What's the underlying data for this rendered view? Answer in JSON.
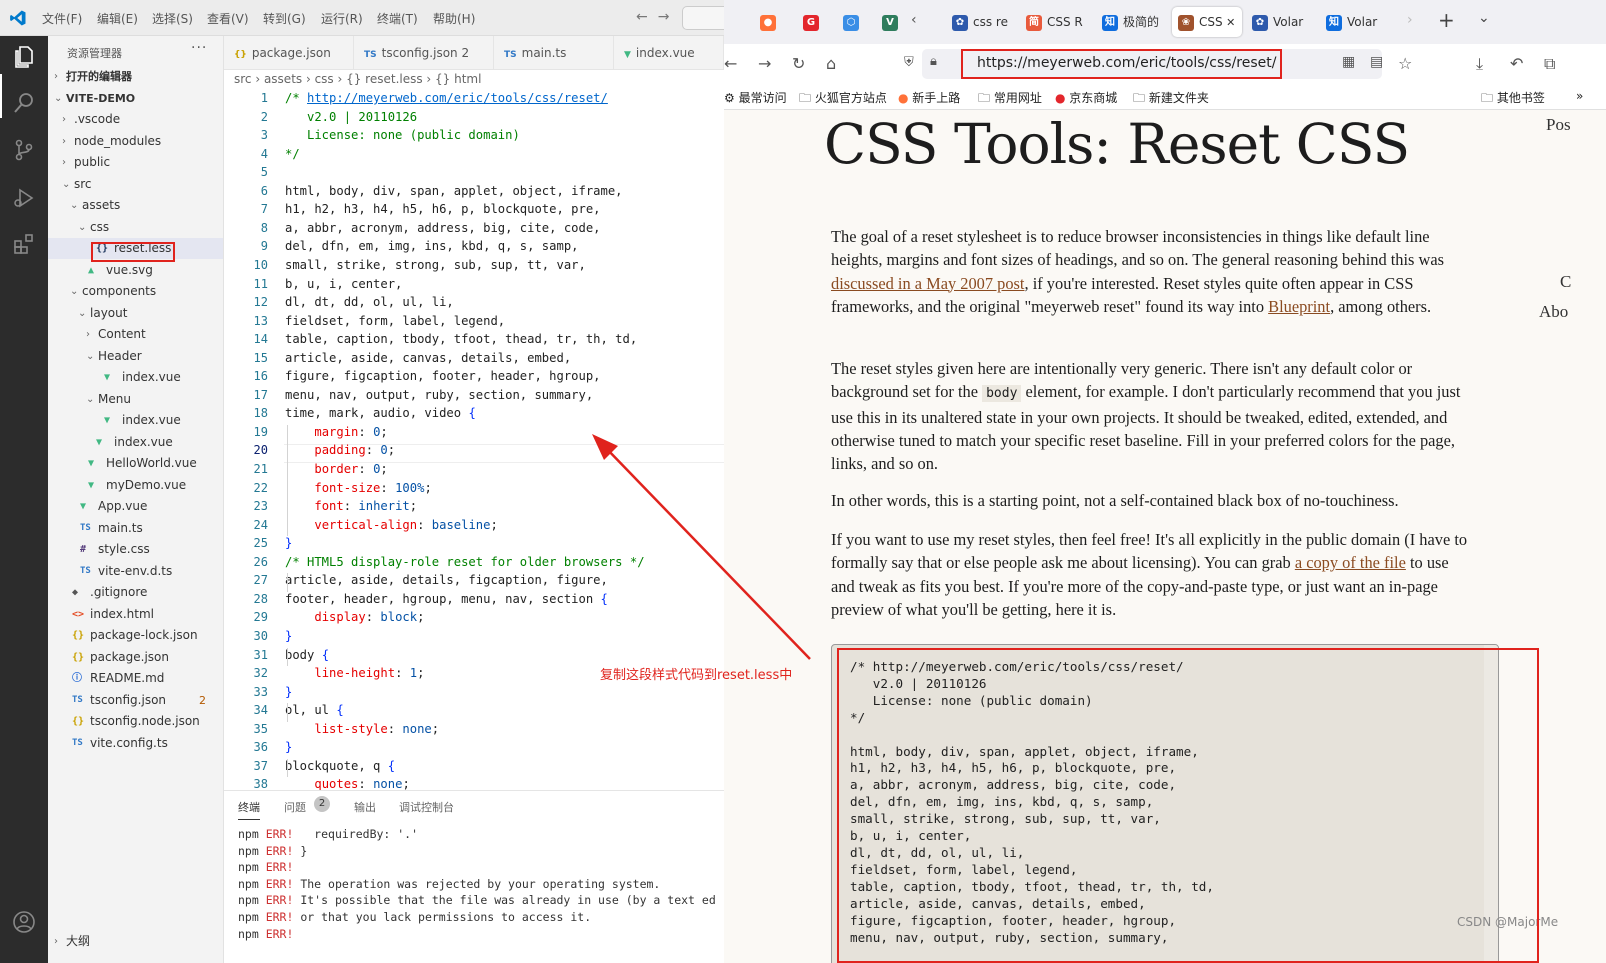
{
  "vscode": {
    "menu": [
      "文件(F)",
      "编辑(E)",
      "选择(S)",
      "查看(V)",
      "转到(G)",
      "运行(R)",
      "终端(T)",
      "帮助(H)"
    ],
    "explorer_title": "资源管理器",
    "more_label": "···",
    "tree": [
      {
        "label": "打开的编辑器",
        "indent": 0,
        "chev": "›",
        "icon": ""
      },
      {
        "label": "VITE-DEMO",
        "indent": 0,
        "chev": "⌄",
        "icon": ""
      },
      {
        "label": ".vscode",
        "indent": 1,
        "chev": "›",
        "icon": ""
      },
      {
        "label": "node_modules",
        "indent": 1,
        "chev": "›",
        "icon": ""
      },
      {
        "label": "public",
        "indent": 1,
        "chev": "›",
        "icon": ""
      },
      {
        "label": "src",
        "indent": 1,
        "chev": "⌄",
        "icon": ""
      },
      {
        "label": "assets",
        "indent": 2,
        "chev": "⌄",
        "icon": ""
      },
      {
        "label": "css",
        "indent": 3,
        "chev": "⌄",
        "icon": ""
      },
      {
        "label": "reset.less",
        "indent": 4,
        "chev": "",
        "icon": "{}",
        "icon_class": "ic-less",
        "selected": true
      },
      {
        "label": "vue.svg",
        "indent": 3,
        "chev": "",
        "icon": "▲",
        "icon_class": "ic-vue"
      },
      {
        "label": "components",
        "indent": 2,
        "chev": "⌄",
        "icon": ""
      },
      {
        "label": "layout",
        "indent": 3,
        "chev": "⌄",
        "icon": ""
      },
      {
        "label": "Content",
        "indent": 4,
        "chev": "›",
        "icon": ""
      },
      {
        "label": "Header",
        "indent": 4,
        "chev": "⌄",
        "icon": ""
      },
      {
        "label": "index.vue",
        "indent": 5,
        "chev": "",
        "icon": "▼",
        "icon_class": "ic-vue"
      },
      {
        "label": "Menu",
        "indent": 4,
        "chev": "⌄",
        "icon": ""
      },
      {
        "label": "index.vue",
        "indent": 5,
        "chev": "",
        "icon": "▼",
        "icon_class": "ic-vue"
      },
      {
        "label": "index.vue",
        "indent": 4,
        "chev": "",
        "icon": "▼",
        "icon_class": "ic-vue"
      },
      {
        "label": "HelloWorld.vue",
        "indent": 3,
        "chev": "",
        "icon": "▼",
        "icon_class": "ic-vue"
      },
      {
        "label": "myDemo.vue",
        "indent": 3,
        "chev": "",
        "icon": "▼",
        "icon_class": "ic-vue"
      },
      {
        "label": "App.vue",
        "indent": 2,
        "chev": "",
        "icon": "▼",
        "icon_class": "ic-vue"
      },
      {
        "label": "main.ts",
        "indent": 2,
        "chev": "",
        "icon": "TS",
        "icon_class": "ic-ts"
      },
      {
        "label": "style.css",
        "indent": 2,
        "chev": "",
        "icon": "#",
        "icon_class": "ic-css"
      },
      {
        "label": "vite-env.d.ts",
        "indent": 2,
        "chev": "",
        "icon": "TS",
        "icon_class": "ic-ts"
      },
      {
        "label": ".gitignore",
        "indent": 1,
        "chev": "",
        "icon": "◆",
        "icon_class": "ic-git"
      },
      {
        "label": "index.html",
        "indent": 1,
        "chev": "",
        "icon": "<>",
        "icon_class": "ic-html"
      },
      {
        "label": "package-lock.json",
        "indent": 1,
        "chev": "",
        "icon": "{}",
        "icon_class": "ic-json"
      },
      {
        "label": "package.json",
        "indent": 1,
        "chev": "",
        "icon": "{}",
        "icon_class": "ic-json"
      },
      {
        "label": "README.md",
        "indent": 1,
        "chev": "",
        "icon": "ⓘ",
        "icon_class": "ic-info"
      },
      {
        "label": "tsconfig.json",
        "indent": 1,
        "chev": "",
        "icon": "TS",
        "icon_class": "ic-ts",
        "badge": "2"
      },
      {
        "label": "tsconfig.node.json",
        "indent": 1,
        "chev": "",
        "icon": "{}",
        "icon_class": "ic-json"
      },
      {
        "label": "vite.config.ts",
        "indent": 1,
        "chev": "",
        "icon": "TS",
        "icon_class": "ic-ts"
      }
    ],
    "bottom_section": "大纲",
    "tabs": [
      {
        "label": "package.json",
        "icon": "{}",
        "icon_class": "ic-json"
      },
      {
        "label": "tsconfig.json 2",
        "icon": "TS",
        "icon_class": "ic-ts"
      },
      {
        "label": "main.ts",
        "icon": "TS",
        "icon_class": "ic-ts"
      },
      {
        "label": "index.vue",
        "icon": "▼",
        "icon_class": "ic-vue"
      }
    ],
    "breadcrumb": "src › assets › css › {} reset.less › {} html",
    "current_line": 20,
    "code_lines": [
      [
        [
          "c-com",
          "/* "
        ],
        [
          "c-link",
          "http://meyerweb.com/eric/tools/css/reset/"
        ]
      ],
      [
        [
          "c-com",
          "   v2.0 | 20110126"
        ]
      ],
      [
        [
          "c-com",
          "   License: none (public domain)"
        ]
      ],
      [
        [
          "c-com",
          "*/"
        ]
      ],
      [
        [
          "",
          ""
        ]
      ],
      [
        [
          "",
          "html, body, div, span, applet, object, iframe,"
        ]
      ],
      [
        [
          "",
          "h1, h2, h3, h4, h5, h6, p, blockquote, pre,"
        ]
      ],
      [
        [
          "",
          "a, abbr, acronym, address, big, cite, code,"
        ]
      ],
      [
        [
          "",
          "del, dfn, em, img, ins, kbd, q, s, samp,"
        ]
      ],
      [
        [
          "",
          "small, strike, strong, sub, sup, tt, var,"
        ]
      ],
      [
        [
          "",
          "b, u, i, center,"
        ]
      ],
      [
        [
          "",
          "dl, dt, dd, ol, ul, li,"
        ]
      ],
      [
        [
          "",
          "fieldset, form, label, legend,"
        ]
      ],
      [
        [
          "",
          "table, caption, tbody, tfoot, thead, tr, th, td,"
        ]
      ],
      [
        [
          "",
          "article, aside, canvas, details, embed,"
        ]
      ],
      [
        [
          "",
          "figure, figcaption, footer, header, hgroup,"
        ]
      ],
      [
        [
          "",
          "menu, nav, output, ruby, section, summary,"
        ]
      ],
      [
        [
          "",
          "time, mark, audio, video "
        ],
        [
          "c-br",
          "{"
        ]
      ],
      [
        [
          "",
          "    "
        ],
        [
          "c-prop",
          "margin"
        ],
        [
          "",
          ": "
        ],
        [
          "c-val",
          "0"
        ],
        [
          "",
          ";"
        ]
      ],
      [
        [
          "",
          "    "
        ],
        [
          "c-prop",
          "padding"
        ],
        [
          "",
          ": "
        ],
        [
          "c-val",
          "0"
        ],
        [
          "",
          ";"
        ]
      ],
      [
        [
          "",
          "    "
        ],
        [
          "c-prop",
          "border"
        ],
        [
          "",
          ": "
        ],
        [
          "c-val",
          "0"
        ],
        [
          "",
          ";"
        ]
      ],
      [
        [
          "",
          "    "
        ],
        [
          "c-prop",
          "font-size"
        ],
        [
          "",
          ": "
        ],
        [
          "c-val",
          "100%"
        ],
        [
          "",
          ";"
        ]
      ],
      [
        [
          "",
          "    "
        ],
        [
          "c-prop",
          "font"
        ],
        [
          "",
          ": "
        ],
        [
          "c-val",
          "inherit"
        ],
        [
          "",
          ";"
        ]
      ],
      [
        [
          "",
          "    "
        ],
        [
          "c-prop",
          "vertical-align"
        ],
        [
          "",
          ": "
        ],
        [
          "c-val",
          "baseline"
        ],
        [
          "",
          ";"
        ]
      ],
      [
        [
          "c-br",
          "}"
        ]
      ],
      [
        [
          "c-com",
          "/* HTML5 display-role reset for older browsers */"
        ]
      ],
      [
        [
          "",
          "article, aside, details, figcaption, figure,"
        ]
      ],
      [
        [
          "",
          "footer, header, hgroup, menu, nav, section "
        ],
        [
          "c-br",
          "{"
        ]
      ],
      [
        [
          "",
          "    "
        ],
        [
          "c-prop",
          "display"
        ],
        [
          "",
          ": "
        ],
        [
          "c-val",
          "block"
        ],
        [
          "",
          ";"
        ]
      ],
      [
        [
          "c-br",
          "}"
        ]
      ],
      [
        [
          "",
          "body "
        ],
        [
          "c-br",
          "{"
        ]
      ],
      [
        [
          "",
          "    "
        ],
        [
          "c-prop",
          "line-height"
        ],
        [
          "",
          ": "
        ],
        [
          "c-val",
          "1"
        ],
        [
          "",
          ";"
        ]
      ],
      [
        [
          "c-br",
          "}"
        ]
      ],
      [
        [
          "",
          "ol, ul "
        ],
        [
          "c-br",
          "{"
        ]
      ],
      [
        [
          "",
          "    "
        ],
        [
          "c-prop",
          "list-style"
        ],
        [
          "",
          ": "
        ],
        [
          "c-val",
          "none"
        ],
        [
          "",
          ";"
        ]
      ],
      [
        [
          "c-br",
          "}"
        ]
      ],
      [
        [
          "",
          "blockquote, q "
        ],
        [
          "c-br",
          "{"
        ]
      ],
      [
        [
          "",
          "    "
        ],
        [
          "c-prop",
          "quotes"
        ],
        [
          "",
          ": "
        ],
        [
          "c-val",
          "none"
        ],
        [
          "",
          ";"
        ]
      ]
    ],
    "panel_tabs": [
      "终端",
      "问题",
      "输出",
      "调试控制台"
    ],
    "problem_count": "2",
    "terminal_lines": [
      [
        [
          "",
          "npm "
        ],
        [
          "err",
          "ERR!"
        ],
        [
          "",
          "   requiredBy: '.'"
        ]
      ],
      [
        [
          "",
          "npm "
        ],
        [
          "err",
          "ERR!"
        ],
        [
          "",
          " }"
        ]
      ],
      [
        [
          "",
          "npm "
        ],
        [
          "err",
          "ERR!"
        ]
      ],
      [
        [
          "",
          "npm "
        ],
        [
          "err",
          "ERR!"
        ],
        [
          "",
          " The operation was rejected by your operating system."
        ]
      ],
      [
        [
          "",
          "npm "
        ],
        [
          "err",
          "ERR!"
        ],
        [
          "",
          " It's possible that the file was already in use (by a text ed"
        ]
      ],
      [
        [
          "",
          "npm "
        ],
        [
          "err",
          "ERR!"
        ],
        [
          "",
          " or that you lack permissions to access it."
        ]
      ],
      [
        [
          "",
          "npm "
        ],
        [
          "err",
          "ERR!"
        ]
      ]
    ]
  },
  "annotation": "复制这段样式代码到reset.less中",
  "browser": {
    "tabs": [
      {
        "label": "",
        "color": "#ff7139",
        "fav": "●"
      },
      {
        "label": "",
        "color": "#e3262c",
        "fav": "G"
      },
      {
        "label": "",
        "color": "#3a8ee6",
        "fav": "⬡"
      },
      {
        "label": "",
        "color": "#2f7d5d",
        "fav": "V"
      },
      {
        "label": "css re",
        "color": "#2e5aac",
        "fav": "✿"
      },
      {
        "label": "CSS R",
        "color": "#e85a3c",
        "fav": "简"
      },
      {
        "label": "极简的",
        "color": "#0f6dde",
        "fav": "知"
      },
      {
        "label": "CSS",
        "color": "#a0522d",
        "fav": "❀",
        "active": true
      },
      {
        "label": "Volar",
        "color": "#2e5aac",
        "fav": "✿"
      },
      {
        "label": "Volar",
        "color": "#0f6dde",
        "fav": "知"
      }
    ],
    "url": "https://meyerweb.com/eric/tools/css/reset/",
    "bookmarks": [
      "最常访问",
      "火狐官方站点",
      "新手上路",
      "常用网址",
      "京东商城",
      "新建文件夹"
    ],
    "other_bookmarks": "其他书签",
    "page": {
      "title": "CSS Tools: Reset CSS",
      "side_pos": "Pos",
      "side_c": "C",
      "side_abo": "Abo",
      "p1_a": "The goal of a reset stylesheet is to reduce browser inconsistencies in things like default line heights, margins and font sizes of headings, and so on. The general reasoning behind this was ",
      "p1_link1": "discussed in a May 2007 post",
      "p1_b": ", if you're interested. Reset styles quite often appear in CSS frameworks, and the original \"meyerweb reset\" found its way into ",
      "p1_link2": "Blueprint",
      "p1_c": ", among others.",
      "p2_a": "The reset styles given here are intentionally very generic. There isn't any default color or background set for the ",
      "p2_code": "body",
      "p2_b": " element, for example. I don't particularly recommend that you just use this in its unaltered state in your own projects. It should be tweaked, edited, extended, and otherwise tuned to match your specific reset baseline. Fill in your preferred colors for the page, links, and so on.",
      "p3": "In other words, this is a starting point, not a self-contained black box of no-touchiness.",
      "p4_a": "If you want to use my reset styles, then feel free! It's all explicitly in the public domain (I have to formally say that or else people ask me about licensing). You can grab ",
      "p4_link": "a copy of the file",
      "p4_b": " to use and tweak as fits you best. If you're more of the copy-and-paste type, or just want an in-page preview of what you'll be getting, here it is.",
      "code": "/* http://meyerweb.com/eric/tools/css/reset/\n   v2.0 | 20110126\n   License: none (public domain)\n*/\n\nhtml, body, div, span, applet, object, iframe,\nh1, h2, h3, h4, h5, h6, p, blockquote, pre,\na, abbr, acronym, address, big, cite, code,\ndel, dfn, em, img, ins, kbd, q, s, samp,\nsmall, strike, strong, sub, sup, tt, var,\nb, u, i, center,\ndl, dt, dd, ol, ul, li,\nfieldset, form, label, legend,\ntable, caption, tbody, tfoot, thead, tr, th, td,\narticle, aside, canvas, details, embed,\nfigure, figcaption, footer, header, hgroup,\nmenu, nav, output, ruby, section, summary,"
    },
    "watermark": "CSDN @MajorMe"
  },
  "colors": {
    "annotation_red": "#e0231d",
    "vscode_blue": "#0066b8",
    "link_brown": "#8a4b21"
  }
}
